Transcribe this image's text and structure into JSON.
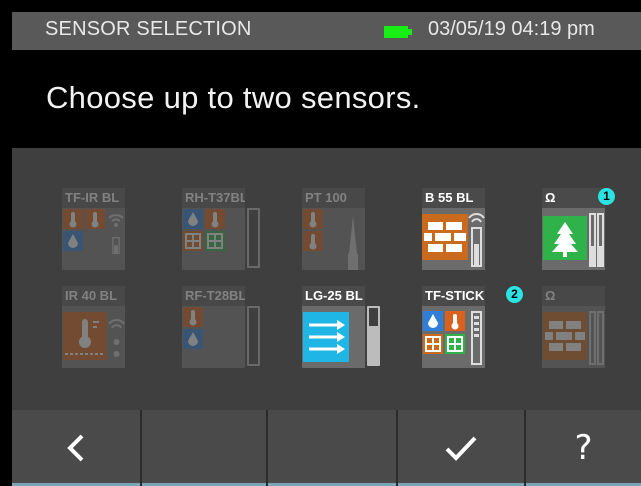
{
  "status_bar": {
    "title": "SENSOR SELECTION",
    "datetime": "03/05/19 04:19 pm",
    "battery_color": "#16ee16"
  },
  "prompt": "Choose up to two sensors.",
  "sensors": [
    {
      "label": "TF-IR BL",
      "state": "unavailable"
    },
    {
      "label": "RH-T37BL",
      "state": "unavailable"
    },
    {
      "label": "PT 100",
      "state": "unavailable"
    },
    {
      "label": "B 55 BL",
      "state": "available"
    },
    {
      "label": "Ω",
      "state": "selected",
      "selection_order": "1"
    },
    {
      "label": "IR 40 BL",
      "state": "unavailable"
    },
    {
      "label": "RF-T28BL",
      "state": "unavailable"
    },
    {
      "label": "LG-25 BL",
      "state": "available"
    },
    {
      "label": "TF-STICK",
      "state": "selected",
      "selection_order": "2"
    },
    {
      "label": "Ω",
      "state": "unavailable"
    }
  ],
  "softkeys": [
    {
      "icon": "back-chevron-icon"
    },
    {
      "icon": "none"
    },
    {
      "icon": "none"
    },
    {
      "icon": "checkmark-icon"
    },
    {
      "label": "?",
      "icon": "help-icon"
    }
  ],
  "colors": {
    "humidity_blue": "#2f7fd8",
    "temperature_orange": "#d9621e",
    "material_orange": "#c96a1c",
    "tree_green": "#2fb24a",
    "flow_cyan": "#1fb6e6",
    "badge_cyan": "#2be3e3"
  }
}
